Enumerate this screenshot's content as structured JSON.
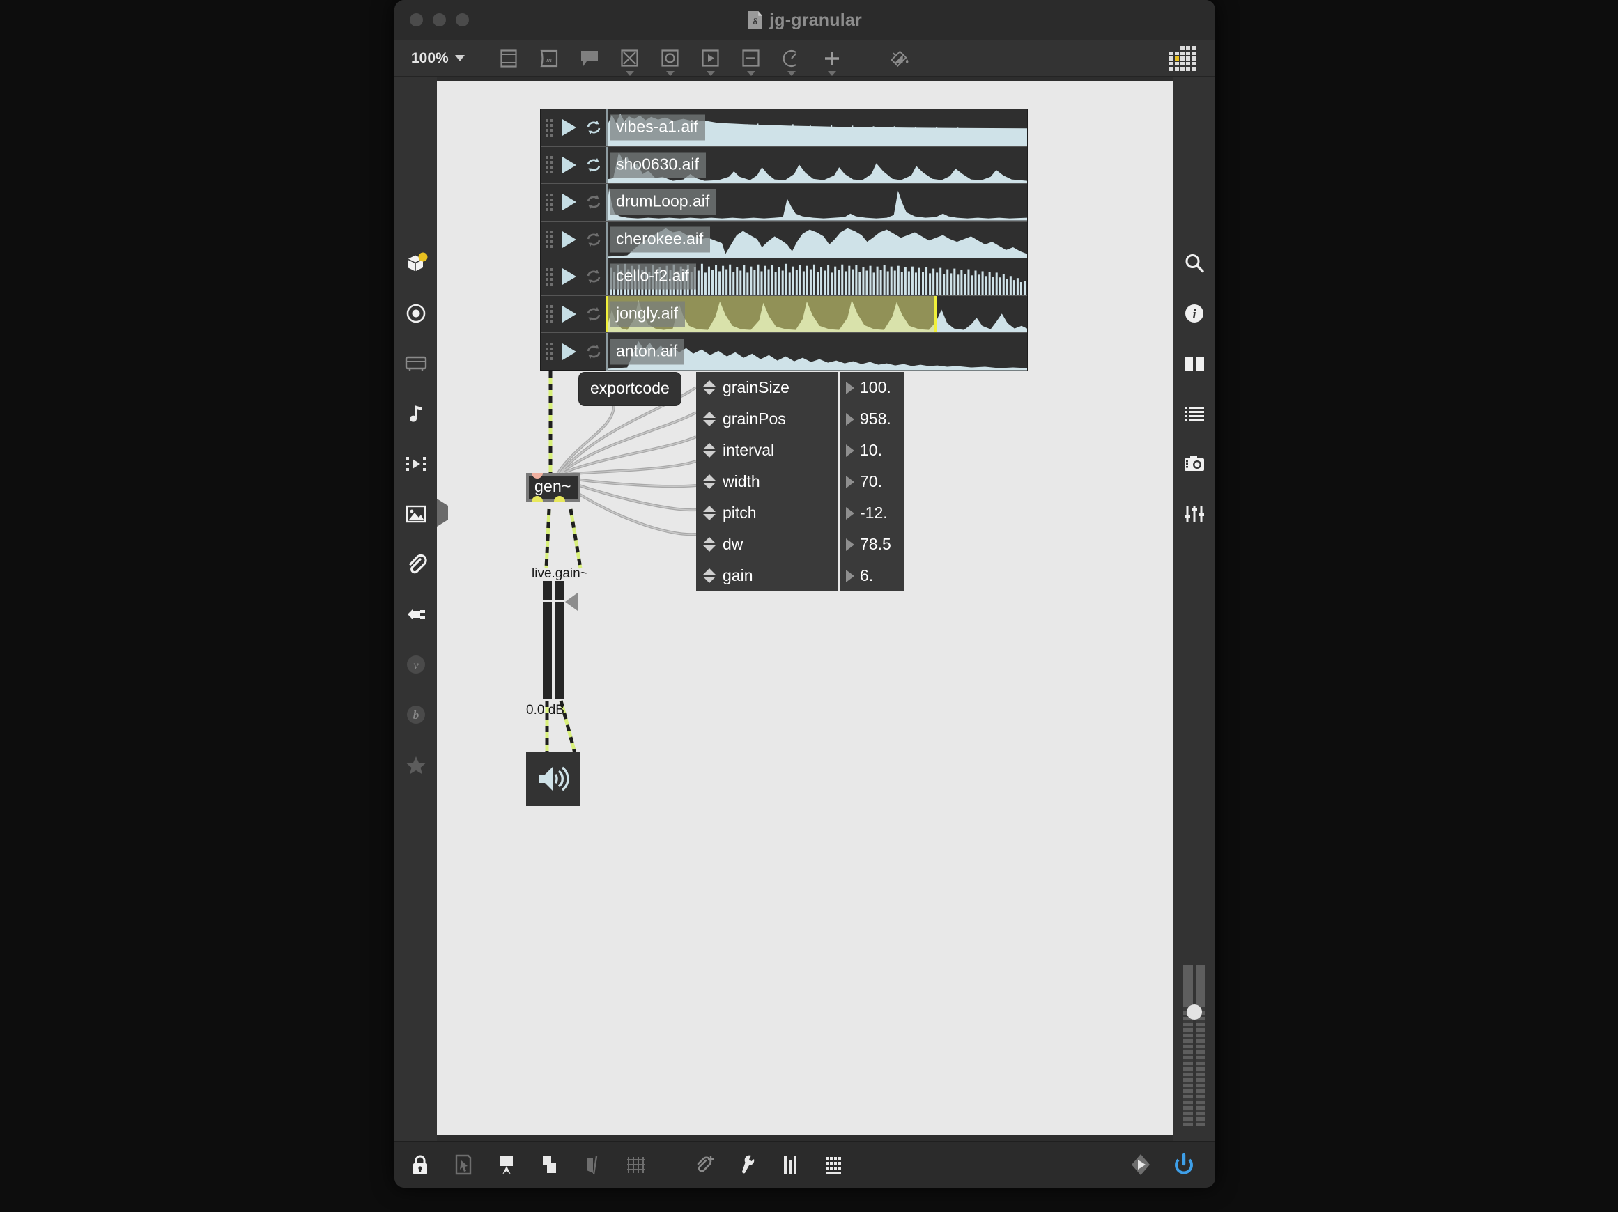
{
  "window": {
    "title": "jg-granular",
    "doc_icon": "patcher-file-icon",
    "doc_glyph": "δ",
    "traffic_lights": [
      "close",
      "minimize",
      "zoom"
    ]
  },
  "toolbar": {
    "zoom_level": "100%",
    "items": [
      {
        "name": "object-box-tool",
        "icon": "object-box-icon"
      },
      {
        "name": "message-box-tool",
        "icon": "message-box-icon"
      },
      {
        "name": "comment-tool",
        "icon": "comment-icon"
      },
      {
        "name": "toggle-tool",
        "icon": "toggle-x-icon"
      },
      {
        "name": "button-tool",
        "icon": "bang-circle-icon"
      },
      {
        "name": "playback-tool",
        "icon": "play-box-icon"
      },
      {
        "name": "slider-tool",
        "icon": "slider-box-icon"
      },
      {
        "name": "dial-tool",
        "icon": "dial-icon"
      },
      {
        "name": "add-object-tool",
        "icon": "plus-icon"
      },
      {
        "name": "paint-tool",
        "icon": "paint-bucket-icon"
      }
    ],
    "grid_button": "pattern-grid-icon"
  },
  "left_sidebar": {
    "items": [
      {
        "name": "sidebar-packages",
        "icon": "package-cube-icon",
        "badge": true
      },
      {
        "name": "sidebar-target",
        "icon": "target-circle-icon",
        "badge": false
      },
      {
        "name": "sidebar-keyboard",
        "icon": "keyboard-icon",
        "badge": false
      },
      {
        "name": "sidebar-audio",
        "icon": "music-note-icon",
        "badge": false
      },
      {
        "name": "sidebar-clips",
        "icon": "clip-play-icon",
        "badge": false
      },
      {
        "name": "sidebar-images",
        "icon": "image-icon",
        "badge": false
      },
      {
        "name": "sidebar-attachments",
        "icon": "paperclip-icon",
        "badge": false
      },
      {
        "name": "sidebar-devices",
        "icon": "plug-icon",
        "badge": false
      },
      {
        "name": "sidebar-vizzie",
        "icon": "vizzie-v-icon",
        "badge": false
      },
      {
        "name": "sidebar-beap",
        "icon": "beap-b-icon",
        "badge": false
      },
      {
        "name": "sidebar-favorites",
        "icon": "star-icon",
        "badge": false
      }
    ],
    "accent": "#e8c020"
  },
  "right_sidebar": {
    "items": [
      {
        "name": "sidebar-search",
        "icon": "search-icon"
      },
      {
        "name": "sidebar-info",
        "icon": "info-icon"
      },
      {
        "name": "sidebar-panels",
        "icon": "split-panel-icon"
      },
      {
        "name": "sidebar-list",
        "icon": "list-icon"
      },
      {
        "name": "sidebar-snapshot",
        "icon": "camera-icon"
      },
      {
        "name": "sidebar-parameters",
        "icon": "sliders-icon"
      }
    ]
  },
  "master_meter": {
    "name": "master-level-meter",
    "channels": 2,
    "knob_position_pct": 24
  },
  "playlist": {
    "name": "sound-file-playlist",
    "rows": [
      {
        "filename": "vibes-a1.aif",
        "loop_active": true,
        "selected": false
      },
      {
        "filename": "sho0630.aif",
        "loop_active": true,
        "selected": false
      },
      {
        "filename": "drumLoop.aif",
        "loop_active": false,
        "selected": false
      },
      {
        "filename": "cherokee.aif",
        "loop_active": false,
        "selected": false
      },
      {
        "filename": "cello-f2.aif",
        "loop_active": false,
        "selected": false
      },
      {
        "filename": "jongly.aif",
        "loop_active": false,
        "selected": true
      },
      {
        "filename": "anton.aif",
        "loop_active": false,
        "selected": false
      }
    ],
    "selection_color": "#e2e278"
  },
  "patch": {
    "message_box": {
      "name": "exportcode-message",
      "label": "exportcode"
    },
    "gen_object": {
      "name": "gen-tilde-object",
      "label": "gen~"
    },
    "gain": {
      "name": "live-gain-slider",
      "label": "live.gain~",
      "value_label": "0.0 dB"
    },
    "dac": {
      "name": "ezdac-object",
      "icon": "speaker-icon"
    },
    "parameters": [
      {
        "name": "grainSize",
        "value": "100."
      },
      {
        "name": "grainPos",
        "value": "958."
      },
      {
        "name": "interval",
        "value": "10."
      },
      {
        "name": "width",
        "value": "70."
      },
      {
        "name": "pitch",
        "value": "-12."
      },
      {
        "name": "dw",
        "value": "78.5"
      },
      {
        "name": "gain",
        "value": "6."
      }
    ]
  },
  "bottom_bar": {
    "items": [
      {
        "name": "lock-patcher-button",
        "icon": "lock-icon"
      },
      {
        "name": "edit-mode-button",
        "icon": "cursor-box-icon"
      },
      {
        "name": "presentation-mode-button",
        "icon": "presentation-icon"
      },
      {
        "name": "arrange-button",
        "icon": "layers-icon"
      },
      {
        "name": "align-button",
        "icon": "align-icon"
      },
      {
        "name": "grid-snap-button",
        "icon": "grid-icon"
      },
      {
        "name": "add-note-button",
        "icon": "paperclip-plus-icon"
      },
      {
        "name": "inspector-button",
        "icon": "wrench-icon"
      },
      {
        "name": "mixer-button",
        "icon": "mixer-icon"
      },
      {
        "name": "keyboard-shortcuts-button",
        "icon": "keyboard-grid-icon"
      },
      {
        "name": "play-transport-button",
        "icon": "play-circle-icon"
      },
      {
        "name": "audio-power-button",
        "icon": "power-icon",
        "color": "#3e9fe8"
      }
    ]
  }
}
